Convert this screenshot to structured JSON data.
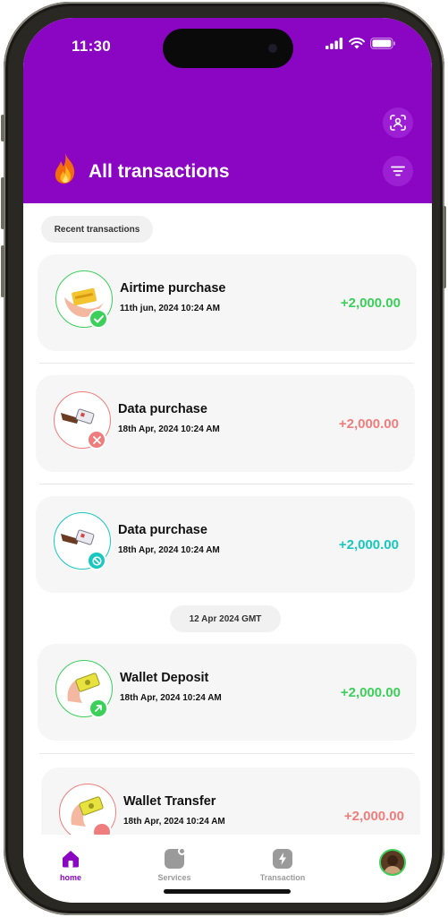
{
  "status_bar": {
    "time": "11:30"
  },
  "header": {
    "title": "All transactions",
    "icons": {
      "scan": "face-scan-icon",
      "filter": "filter-icon",
      "emoji": "fire-icon"
    }
  },
  "sections": {
    "recent_label": "Recent transactions",
    "date_label": "12 Apr 2024 GMT"
  },
  "colors": {
    "brand": "#8a06c2",
    "success": "#3ccf5a",
    "failed": "#f07d7d",
    "pending": "#17c8c0"
  },
  "transactions": [
    {
      "title": "Airtime purchase",
      "date": "11th jun, 2024 10:24 AM",
      "amount": "+2,000.00",
      "status": "success"
    },
    {
      "title": "Data purchase",
      "date": "18th Apr, 2024 10:24 AM",
      "amount": "+2,000.00",
      "status": "failed"
    },
    {
      "title": "Data purchase",
      "date": "18th Apr, 2024 10:24 AM",
      "amount": "+2,000.00",
      "status": "cancelled"
    },
    {
      "title": "Wallet Deposit",
      "date": "18th Apr, 2024 10:24 AM",
      "amount": "+2,000.00",
      "status": "deposit"
    },
    {
      "title": "Wallet Transfer",
      "date": "18th Apr, 2024 10:24 AM",
      "amount": "+2,000.00",
      "status": "transfer"
    }
  ],
  "tabbar": {
    "items": [
      {
        "label": "home",
        "icon": "home-icon",
        "active": true
      },
      {
        "label": "Services",
        "icon": "services-icon",
        "active": false
      },
      {
        "label": "Transaction",
        "icon": "transaction-icon",
        "active": false
      },
      {
        "label": "",
        "icon": "profile-avatar",
        "active": false
      }
    ]
  }
}
